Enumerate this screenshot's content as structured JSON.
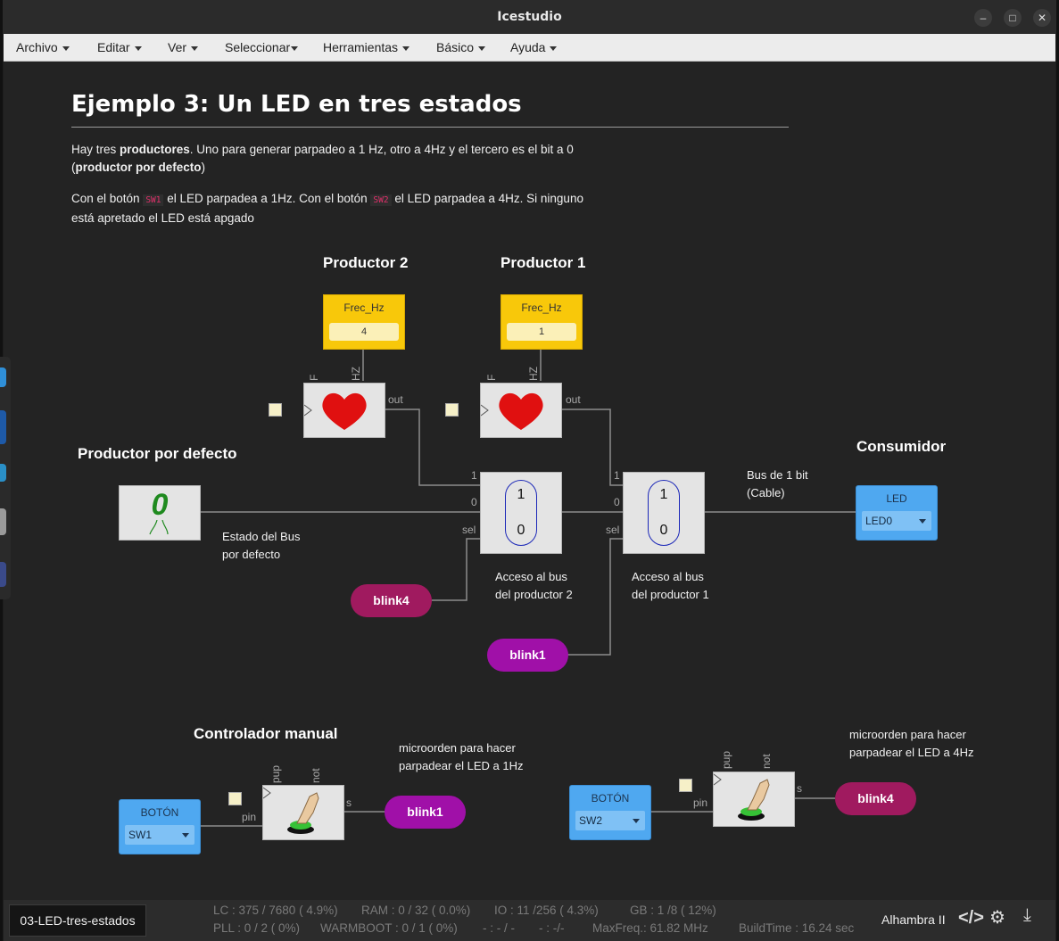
{
  "window": {
    "title": "Icestudio",
    "controls": [
      "minimize",
      "maximize",
      "close"
    ]
  },
  "menu": [
    {
      "label": "Archivo"
    },
    {
      "label": "Editar"
    },
    {
      "label": "Ver"
    },
    {
      "label": "Seleccionar"
    },
    {
      "label": "Herramientas"
    },
    {
      "label": "Básico"
    },
    {
      "label": "Ayuda"
    }
  ],
  "doc": {
    "title": "Ejemplo 3: Un LED en tres estados",
    "p1": {
      "t1": "Hay tres ",
      "b1": "productores",
      "t2": ". Uno para generar parpadeo a 1 Hz, otro a 4Hz y el tercero es el bit a 0",
      "t3": "(",
      "b2": "productor por defecto",
      "t4": ")"
    },
    "p2": {
      "t1": "Con el botón ",
      "c1": "SW1",
      "t2": " el LED parpadea a 1Hz. Con el botón ",
      "c2": "SW2",
      "t3": " el LED parpadea a 4Hz. Si ninguno",
      "t4": "está apretado el LED está apgado"
    }
  },
  "headings": {
    "productor2": "Productor 2",
    "productor1": "Productor 1",
    "productor_defecto": "Productor por defecto",
    "consumidor": "Consumidor",
    "controlador": "Controlador manual"
  },
  "notes": {
    "estado_bus_1": "Estado del Bus",
    "estado_bus_2": "por defecto",
    "bus_bit_1": "Bus de 1 bit",
    "bus_bit_2": "(Cable)",
    "acceso2_1": "Acceso al bus",
    "acceso2_2": "del productor 2",
    "acceso1_1": "Acceso al bus",
    "acceso1_2": "del productor 1",
    "micro1_1": "microorden para hacer",
    "micro1_2": "parpadear el LED a 1Hz",
    "micro4_1": "microorden para hacer",
    "micro4_2": "parpadear el LED a 4Hz"
  },
  "constants": {
    "c2": {
      "label": "Frec_Hz",
      "value": "4"
    },
    "c1": {
      "label": "Frec_Hz",
      "value": "1"
    }
  },
  "ports": {
    "F": "F",
    "HZ": "HZ",
    "out": "out",
    "one": "1",
    "zero": "0",
    "sel": "sel",
    "pup": "pup",
    "not": "not",
    "pin": "pin",
    "s": "s"
  },
  "default_producer": {
    "value": "0"
  },
  "mux": {
    "top": "1",
    "bottom": "0"
  },
  "led": {
    "label": "LED",
    "value": "LED0"
  },
  "buttons": {
    "b1": {
      "label": "BOTÓN",
      "value": "SW1"
    },
    "b2": {
      "label": "BOTÓN",
      "value": "SW2"
    }
  },
  "labels": {
    "blink4_top": "blink4",
    "blink1_top": "blink1",
    "blink1_bottom": "blink1",
    "blink4_bottom": "blink4"
  },
  "colors": {
    "blink4": "#a01a5f",
    "blink1": "#a010a8",
    "constant": "#f8c80a",
    "io": "#4fa8f0",
    "mux_outline": "#1c28b8",
    "heart": "#e01010",
    "zero_glyph": "#1f8a1f"
  },
  "status": {
    "file": "03-LED-tres-estados",
    "lc": "LC : 375 / 7680 ( 4.9%)",
    "ram": "RAM : 0 / 32 ( 0.0%)",
    "io": "IO :  11 /256  ( 4.3%)",
    "gb": "GB :  1 /8  ( 12%)",
    "pll": "PLL : 0 / 2 ( 0%)",
    "warmboot": "WARMBOOT : 0 / 1 ( 0%)",
    "t1": "- : - / -",
    "t2": "- :  -/-",
    "maxfreq": "MaxFreq.:  61.82 MHz",
    "buildtime": "BuildTime :  16.24 sec",
    "board": "Alhambra II",
    "icons": [
      "code-icon",
      "settings-code-icon",
      "download-icon"
    ]
  }
}
